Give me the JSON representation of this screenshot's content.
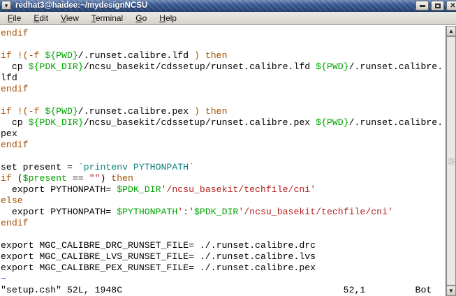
{
  "window": {
    "title": "redhat3@haidee:~/mydesignNCSU"
  },
  "icons": {
    "menu": "▾",
    "close": "✕",
    "scroll_up": "▲",
    "scroll_down": "▼"
  },
  "menu": {
    "items": [
      {
        "label": "File"
      },
      {
        "label": "Edit"
      },
      {
        "label": "View"
      },
      {
        "label": "Terminal"
      },
      {
        "label": "Go"
      },
      {
        "label": "Help"
      }
    ]
  },
  "terminal": {
    "colors": {
      "k": "#a55000",
      "v": "#00a400",
      "s": "#b52020",
      "b": "#0e8181",
      "n": "#000000",
      "nt": "#2b2bcd"
    },
    "lines": [
      [
        {
          "t": "endif",
          "c": "k"
        }
      ],
      [],
      [
        {
          "t": "if !(-f ",
          "c": "k"
        },
        {
          "t": "${PWD}",
          "c": "v"
        },
        {
          "t": "/.runset.calibre.lfd ",
          "c": "n"
        },
        {
          "t": ") then",
          "c": "k"
        }
      ],
      [
        {
          "t": "  cp ",
          "c": "n"
        },
        {
          "t": "${PDK_DIR}",
          "c": "v"
        },
        {
          "t": "/ncsu_basekit/cdssetup/runset.calibre.lfd ",
          "c": "n"
        },
        {
          "t": "${PWD}",
          "c": "v"
        },
        {
          "t": "/.runset.calibre.",
          "c": "n"
        }
      ],
      [
        {
          "t": "lfd",
          "c": "n"
        }
      ],
      [
        {
          "t": "endif",
          "c": "k"
        }
      ],
      [],
      [
        {
          "t": "if !(-f ",
          "c": "k"
        },
        {
          "t": "${PWD}",
          "c": "v"
        },
        {
          "t": "/.runset.calibre.pex ",
          "c": "n"
        },
        {
          "t": ") then",
          "c": "k"
        }
      ],
      [
        {
          "t": "  cp ",
          "c": "n"
        },
        {
          "t": "${PDK_DIR}",
          "c": "v"
        },
        {
          "t": "/ncsu_basekit/cdssetup/runset.calibre.pex ",
          "c": "n"
        },
        {
          "t": "${PWD}",
          "c": "v"
        },
        {
          "t": "/.runset.calibre.",
          "c": "n"
        }
      ],
      [
        {
          "t": "pex",
          "c": "n"
        }
      ],
      [
        {
          "t": "endif",
          "c": "k"
        }
      ],
      [],
      [
        {
          "t": "set present = ",
          "c": "n"
        },
        {
          "t": "`printenv PYTHONPATH`",
          "c": "b"
        }
      ],
      [
        {
          "t": "if ",
          "c": "k"
        },
        {
          "t": "(",
          "c": "n"
        },
        {
          "t": "$present",
          "c": "v"
        },
        {
          "t": " == ",
          "c": "n"
        },
        {
          "t": "\"\"",
          "c": "s"
        },
        {
          "t": ") ",
          "c": "n"
        },
        {
          "t": "then",
          "c": "k"
        }
      ],
      [
        {
          "t": "  export PYTHONPATH= ",
          "c": "n"
        },
        {
          "t": "$PDK_DIR",
          "c": "v"
        },
        {
          "t": "'/ncsu_basekit/techfile/cni'",
          "c": "s"
        }
      ],
      [
        {
          "t": "else",
          "c": "k"
        }
      ],
      [
        {
          "t": "  export PYTHONPATH= ",
          "c": "n"
        },
        {
          "t": "$PYTHONPATH",
          "c": "v"
        },
        {
          "t": "':'",
          "c": "s"
        },
        {
          "t": "$PDK_DIR",
          "c": "v"
        },
        {
          "t": "'/ncsu_basekit/techfile/cni'",
          "c": "s"
        }
      ],
      [
        {
          "t": "endif",
          "c": "k"
        }
      ],
      [],
      [
        {
          "t": "export MGC_CALIBRE_DRC_RUNSET_FILE= ./.runset.calibre.drc",
          "c": "n"
        }
      ],
      [
        {
          "t": "export MGC_CALIBRE_LVS_RUNSET_FILE= ./.runset.calibre.lvs",
          "c": "n"
        }
      ],
      [
        {
          "t": "export MGC_CALIBRE_PEX_RUNSET_FILE= ./.runset.calibre.pex",
          "c": "n"
        }
      ],
      [
        {
          "t": "~",
          "c": "nt"
        }
      ]
    ],
    "status": {
      "left": "\"setup.csh\" 52L, 1948C",
      "ruler": "52,1",
      "position": "Bot"
    }
  }
}
